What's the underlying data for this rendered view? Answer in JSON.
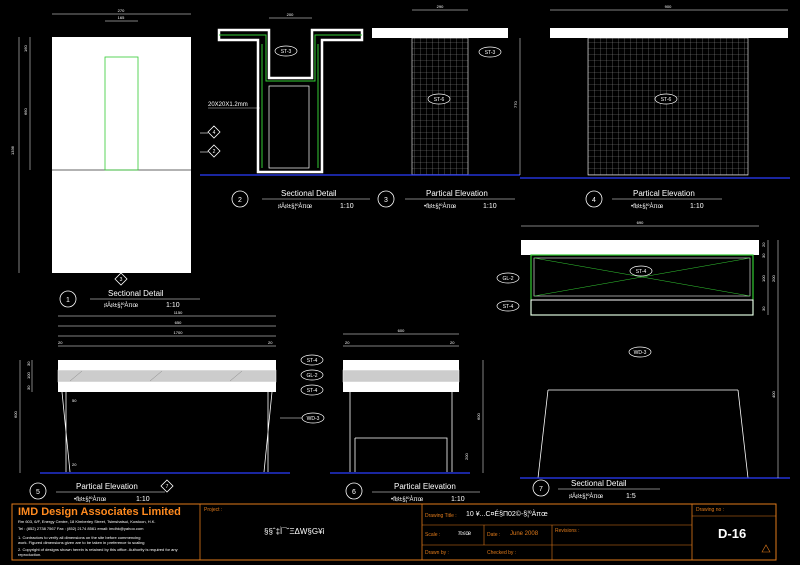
{
  "drawings": {
    "d1": {
      "num": "1",
      "title": "Sectional Detail",
      "subtitle": "♯Ä♯±§¦ºÀπœ",
      "scale": "1:10"
    },
    "d2": {
      "num": "2",
      "title": "Sectional Detail",
      "subtitle": "♯Ä♯±§¦ºÀπœ",
      "scale": "1:10"
    },
    "d3": {
      "num": "3",
      "title": "Partical  Elevation",
      "subtitle": "•ﬂ♯±§¦ºÀπœ",
      "scale": "1:10"
    },
    "d4": {
      "num": "4",
      "title": "Partical  Elevation",
      "subtitle": "•ﬂ♯±§¦ºÀπœ",
      "scale": "1:10"
    },
    "d5": {
      "num": "5",
      "title": "Partical  Elevation",
      "subtitle": "•ﬂ♯±§¦ºÀπœ",
      "scale": "1:10"
    },
    "d6": {
      "num": "6",
      "title": "Partical  Elevation",
      "subtitle": "•ﬂ♯±§¦ºÀπœ",
      "scale": "1:10"
    },
    "d7": {
      "num": "7",
      "title": "Sectional Detail",
      "subtitle": "♯Ä♯±§¦ºÀπœ",
      "scale": "1:5"
    }
  },
  "tags": {
    "st3a": "ST-3",
    "st3b": "ST-3",
    "st6a": "ST-6",
    "st6b": "ST-6",
    "st4a": "ST-4",
    "gl2a": "GL-2",
    "st4b": "ST-4",
    "st4c": "ST-4",
    "gl2b": "GL-2",
    "st4d": "ST-4",
    "wd3a": "WD-3",
    "wd3b": "WD-3"
  },
  "notes": {
    "tube": "20X20X1.2mm"
  },
  "callouts": {
    "c4": "4",
    "c2": "2",
    "c3": "3",
    "c7": "7"
  },
  "dims": {
    "d1_top": "270",
    "d1_top2": "165",
    "d1_left": "1336",
    "d1_left2": "660",
    "d1_left3": "160",
    "d2_width": "200",
    "d3_width": "290",
    "d3_height": "770",
    "d4_width": "900",
    "d5_a": "1150",
    "d5_b": "650",
    "d5_c": "1700",
    "d5_20a": "20",
    "d5_20b": "20",
    "d5_30a": "30",
    "d5_100": "100",
    "d5_30b": "30",
    "d5_600": "600",
    "d5_50": "50",
    "d5_20c": "20",
    "d6_width": "600",
    "d6_20a": "20",
    "d6_20b": "20",
    "d6_600": "600",
    "d6_200": "200",
    "d7_width": "690",
    "d7_20a": "20",
    "d7_30": "30",
    "d7_100": "100",
    "d7_200": "200",
    "d7_30b": "30",
    "d7_400": "400"
  },
  "title_block": {
    "company": "IMD Design Associates Limited",
    "address": "Rm 603, 6/F, Energy Centre, 18 Kimberley Street, Tsimshatsui, Kowloon, H.K.",
    "phone": "Tel : (852) 2738 7567      Fax : (852) 2174 8561      email: imdhk@yahoo.com",
    "note1": "1. Contractors to verify all dimensions on the site before commencing",
    "note1b": "   work. Figured dimensions given are to be taken in preference to scaling",
    "note2": "2. Copyright of designs shown herein is retained by this office. Authority is required for any",
    "note2b": "   reproduction.",
    "project_label": "Project :",
    "project_value": "§§ˆ‡Ì¯˘ΞΔW§G¥ì",
    "drawing_title_label": "Drawing Title :",
    "drawing_title_value": "10 ¥...C¤É§Π02©-§¦ºÀπœ",
    "scale_label": "Scale :",
    "scale_value": "π≤œ",
    "date_label": "Date :",
    "date_value": "June 2008",
    "revisions_label": "Revisions :",
    "drawn_label": "Drawn by :",
    "checked_label": "Checked by :",
    "drawing_no_label": "Drawing no :",
    "drawing_no": "D-16"
  },
  "colors": {
    "bg": "#000000",
    "line": "#ffffff",
    "green": "#33cc33",
    "orange": "#e07a1a",
    "blue": "#2a3cff",
    "grid": "#888888"
  }
}
